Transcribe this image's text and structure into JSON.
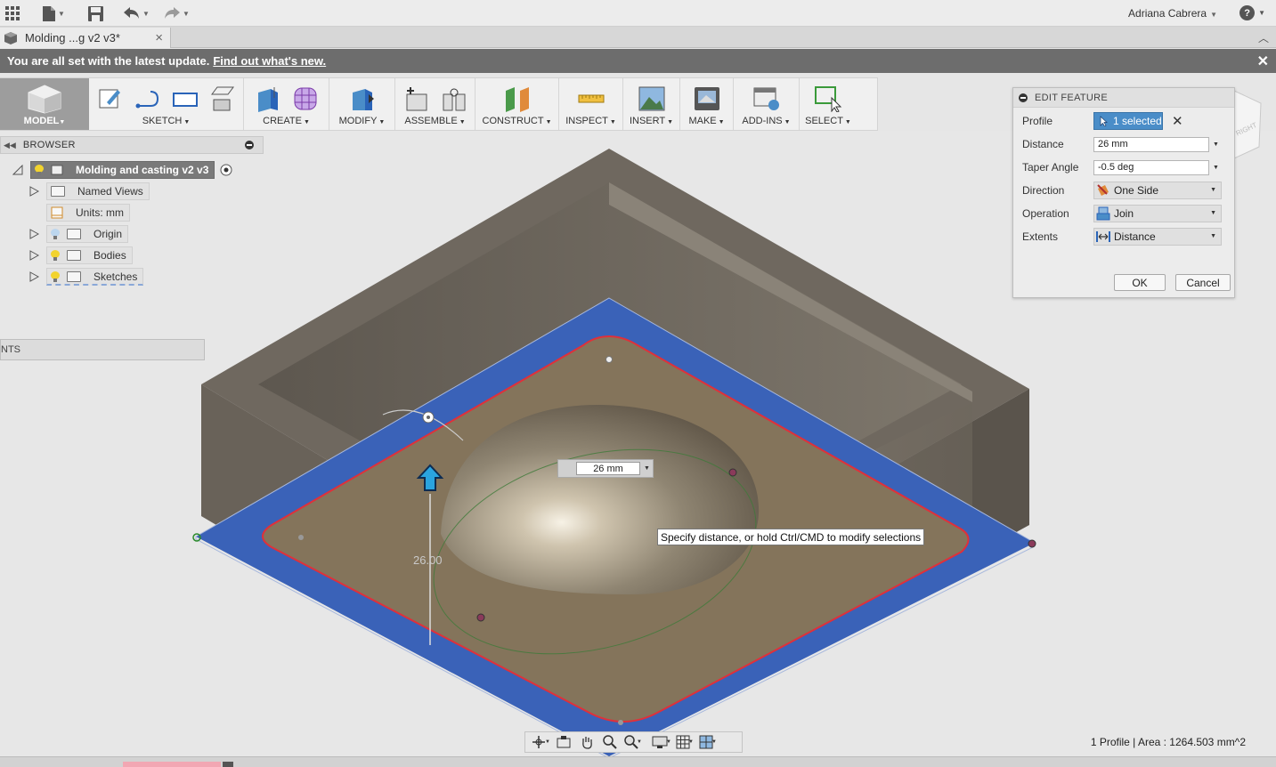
{
  "app": {
    "user_name": "Adriana Cabrera",
    "document_tab": "Molding ...g v2 v3*",
    "help_glyph": "?"
  },
  "banner": {
    "text": "You are all set with the latest update.",
    "link": "Find out what's new."
  },
  "ribbon": {
    "workspace": "MODEL",
    "groups": [
      {
        "label": "SKETCH"
      },
      {
        "label": "CREATE"
      },
      {
        "label": "MODIFY"
      },
      {
        "label": "ASSEMBLE"
      },
      {
        "label": "CONSTRUCT"
      },
      {
        "label": "INSPECT"
      },
      {
        "label": "INSERT"
      },
      {
        "label": "MAKE"
      },
      {
        "label": "ADD-INS"
      },
      {
        "label": "SELECT"
      }
    ]
  },
  "browser": {
    "title": "BROWSER",
    "root": "Molding and casting v2 v3",
    "items": [
      {
        "label": "Named Views"
      },
      {
        "label": "Units: mm"
      },
      {
        "label": "Origin"
      },
      {
        "label": "Bodies"
      },
      {
        "label": "Sketches"
      }
    ],
    "comments_label": "NTS"
  },
  "viewport": {
    "dimension_input": "26 mm",
    "dimension_label": "26.00",
    "tooltip": "Specify distance, or hold Ctrl/CMD to modify selections",
    "viewcube_label": "RIGHT"
  },
  "dialog": {
    "title": "EDIT FEATURE",
    "profile_label": "Profile",
    "profile_value": "1 selected",
    "distance_label": "Distance",
    "distance_value": "26 mm",
    "taper_label": "Taper Angle",
    "taper_value": "-0.5 deg",
    "direction_label": "Direction",
    "direction_value": "One Side",
    "operation_label": "Operation",
    "operation_value": "Join",
    "extents_label": "Extents",
    "extents_value": "Distance",
    "ok": "OK",
    "cancel": "Cancel"
  },
  "status": {
    "text": "1 Profile | Area : 1264.503 mm^2"
  },
  "colors": {
    "selection_blue": "#3a62b8",
    "profile_red": "#e0303a",
    "body_gray": "#6a6258",
    "accent_button": "#4a8dc8"
  }
}
